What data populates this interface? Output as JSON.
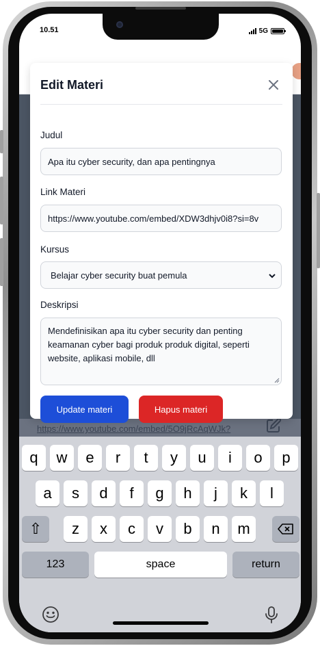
{
  "status_bar": {
    "time": "10.51",
    "network": "5G"
  },
  "background": {
    "link_text": "https://www.youtube.com/embed/5O9jRcAqWJk?"
  },
  "modal": {
    "title": "Edit Materi",
    "fields": {
      "judul": {
        "label": "Judul",
        "value": "Apa itu cyber security, dan apa pentingnya"
      },
      "link": {
        "label": "Link Materi",
        "value": "https://www.youtube.com/embed/XDW3dhjv0i8?si=8v"
      },
      "kursus": {
        "label": "Kursus",
        "selected": "Belajar cyber security buat pemula"
      },
      "deskripsi": {
        "label": "Deskripsi",
        "value": "Mendefinisikan apa itu cyber security dan penting keamanan cyber bagi produk produk digital, seperti website, aplikasi mobile, dll"
      }
    },
    "buttons": {
      "update": "Update materi",
      "delete": "Hapus materi"
    }
  },
  "keyboard": {
    "row1": [
      "q",
      "w",
      "e",
      "r",
      "t",
      "y",
      "u",
      "i",
      "o",
      "p"
    ],
    "row2": [
      "a",
      "s",
      "d",
      "f",
      "g",
      "h",
      "j",
      "k",
      "l"
    ],
    "row3": [
      "z",
      "x",
      "c",
      "v",
      "b",
      "n",
      "m"
    ],
    "shift": "⇧",
    "numbers": "123",
    "space": "space",
    "return": "return"
  },
  "colors": {
    "primary": "#1d4ed8",
    "danger": "#dc2626",
    "overlay": "#4b5563"
  }
}
